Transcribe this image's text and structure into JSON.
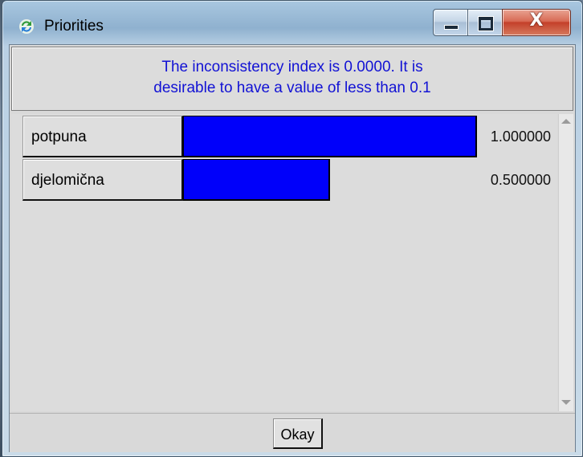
{
  "window": {
    "title": "Priorities",
    "icon": "refresh-arrows-icon",
    "controls": {
      "minimize": "minimize-icon",
      "maximize": "maximize-icon",
      "close_glyph": "X"
    }
  },
  "message": {
    "line1": "The inconsistency index is 0.0000.  It is",
    "line2": "desirable to have a value of less than 0.1"
  },
  "priorities": [
    {
      "label": "potpuna",
      "value": "1.000000",
      "weight": 1.0
    },
    {
      "label": "djelomična",
      "value": "0.500000",
      "weight": 0.5
    }
  ],
  "buttons": {
    "okay": "Okay"
  },
  "colors": {
    "bar": "#0000fa",
    "message_text": "#1212d4",
    "panel_bg": "#d9d9d9"
  }
}
